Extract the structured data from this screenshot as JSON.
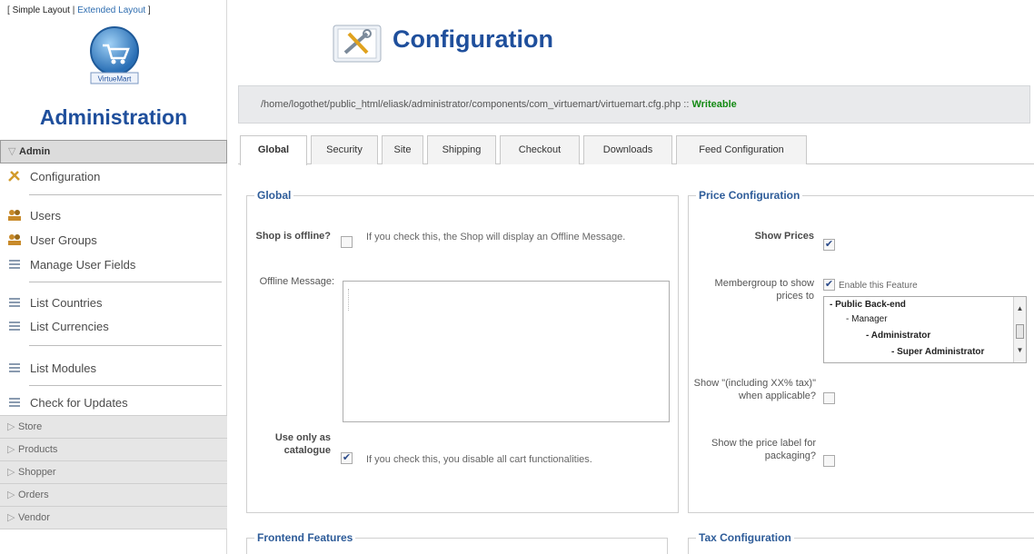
{
  "sidebar": {
    "layout_simple": "Simple Layout",
    "layout_extended": "Extended Layout",
    "logo_text": "VirtueMart",
    "title": "Administration",
    "admin_section": "Admin",
    "items": {
      "configuration": "Configuration",
      "users": "Users",
      "user_groups": "User Groups",
      "manage_user_fields": "Manage User Fields",
      "list_countries": "List Countries",
      "list_currencies": "List Currencies",
      "list_modules": "List Modules",
      "check_updates": "Check for Updates"
    },
    "sections": {
      "store": "Store",
      "products": "Products",
      "shopper": "Shopper",
      "orders": "Orders",
      "vendor": "Vendor"
    }
  },
  "header": {
    "title": "Configuration",
    "path": "/home/logothet/public_html/eliask/administrator/components/com_virtuemart/virtuemart.cfg.php",
    "path_sep": " :: ",
    "path_status": "Writeable"
  },
  "tabs": [
    "Global",
    "Security",
    "Site",
    "Shipping",
    "Checkout",
    "Downloads",
    "Feed Configuration"
  ],
  "global": {
    "legend": "Global",
    "shop_offline_label": "Shop is offline?",
    "shop_offline_hint": "If you check this, the Shop will display an Offline Message.",
    "offline_message_label": "Offline Message:",
    "catalogue_label": "Use only as catalogue",
    "catalogue_hint": "If you check this, you disable all cart functionalities."
  },
  "price": {
    "legend": "Price Configuration",
    "show_prices_label": "Show Prices",
    "membergroup_label": "Membergroup to show prices to",
    "enable_feature": "Enable this Feature",
    "groups": [
      "- Public Back-end",
      "- Manager",
      "- Administrator",
      "- Super Administrator"
    ],
    "incl_tax_label": "Show \"(including XX% tax)\" when applicable?",
    "price_label_label": "Show the price label for packaging?"
  },
  "frontend_legend": "Frontend Features",
  "tax_legend": "Tax Configuration",
  "checks": {
    "shop_offline": false,
    "use_as_catalogue": true,
    "show_prices": true,
    "membergroup_enable": true,
    "show_incl_tax": false,
    "show_price_label": false
  },
  "colors": {
    "title_blue": "#1f4f9c",
    "legend_blue": "#2e5c99",
    "writeable_green": "#138a13"
  }
}
